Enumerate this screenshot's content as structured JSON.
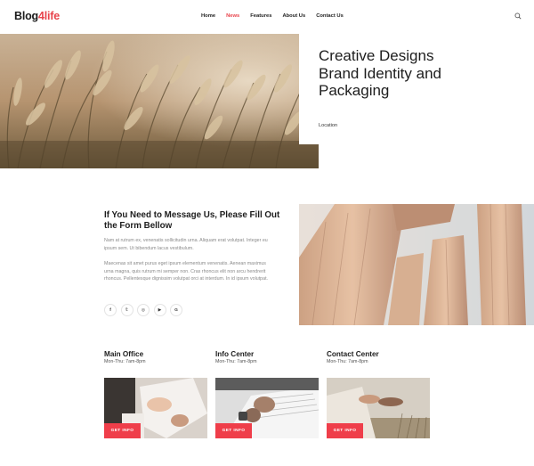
{
  "header": {
    "logo_main": "Blog",
    "logo_accent": "4life",
    "nav": [
      {
        "label": "Home",
        "active": false
      },
      {
        "label": "News",
        "active": true
      },
      {
        "label": "Features",
        "active": false
      },
      {
        "label": "About Us",
        "active": false
      },
      {
        "label": "Contact Us",
        "active": false
      }
    ],
    "search_icon": "search-icon"
  },
  "hero": {
    "title": "Creative Designs Brand Identity and Packaging",
    "location": "Location"
  },
  "message": {
    "title": "If You Need to Message Us, Please Fill Out the Form Bellow",
    "paragraph1": "Nam at rutrum ex, venenatis sollicitudin urna. Aliquam erat volutpat. Integer eu ipsum sem. Ut bibendum lacus vestibulum.",
    "paragraph2": "Maecenas sit amet purus eget ipsum elementum venenatis. Aenean maximus urna magna, quis rutrum mi semper non. Cras rhoncus elit non arcu hendrerit rhoncus. Pellentesque dignissim volutpat orci at interdum. In id ipsum volutpat.",
    "socials": [
      {
        "icon": "facebook-icon",
        "glyph": "f"
      },
      {
        "icon": "twitter-icon",
        "glyph": "𝕥"
      },
      {
        "icon": "instagram-icon",
        "glyph": "◎"
      },
      {
        "icon": "youtube-icon",
        "glyph": "▶"
      },
      {
        "icon": "google-icon",
        "glyph": "G"
      }
    ]
  },
  "offices": [
    {
      "title": "Main Office",
      "hours": "Mon-Thu: 7am-8pm",
      "button": "GET INFO"
    },
    {
      "title": "Info Center",
      "hours": "Mon-Thu: 7am-8pm",
      "button": "GET INFO"
    },
    {
      "title": "Contact Center",
      "hours": "Mon-Thu: 7am-8pm",
      "button": "GET INFO"
    }
  ],
  "colors": {
    "accent": "#ef3e4a",
    "text": "#1d1d1d"
  }
}
